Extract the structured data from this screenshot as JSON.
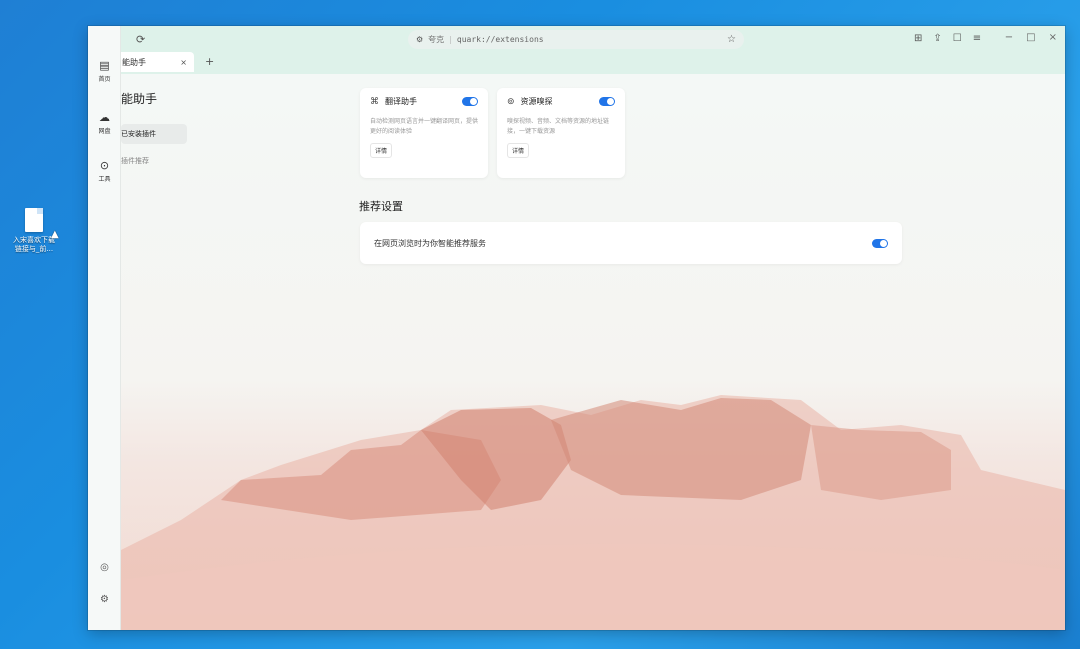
{
  "desktop": {
    "file_label_line1": "入宋喜欢下载",
    "file_label_line2": "链接与_前..."
  },
  "browser": {
    "tab_label": "能助手",
    "tab_close": "×",
    "new_tab": "+",
    "address_prefix": "夸克",
    "url": "quark://extensions",
    "window_controls": [
      "−",
      "□",
      "×"
    ]
  },
  "sidebar": {
    "items": [
      {
        "icon": "home-icon",
        "label": "首页"
      },
      {
        "icon": "cloud-icon",
        "label": "网盘"
      },
      {
        "icon": "tools-icon",
        "label": "工具"
      }
    ]
  },
  "left_panel": {
    "title": "能助手",
    "selected_item": "已安装插件",
    "other_item": "插件推荐"
  },
  "cards": [
    {
      "icon": "translate-icon",
      "title": "翻译助手",
      "enabled": true,
      "desc": "自动检测网页语言并一键翻译网页，提供更好的阅读体验",
      "more_label": "详情"
    },
    {
      "icon": "resource-sniff-icon",
      "title": "资源嗅探",
      "enabled": true,
      "desc": "嗅探视频、音频、文档等资源的地址链接，一键下载资源",
      "more_label": "详情"
    }
  ],
  "recommend": {
    "section_title": "推荐设置",
    "row_label": "在网页浏览时为你智能推荐服务",
    "enabled": true
  }
}
